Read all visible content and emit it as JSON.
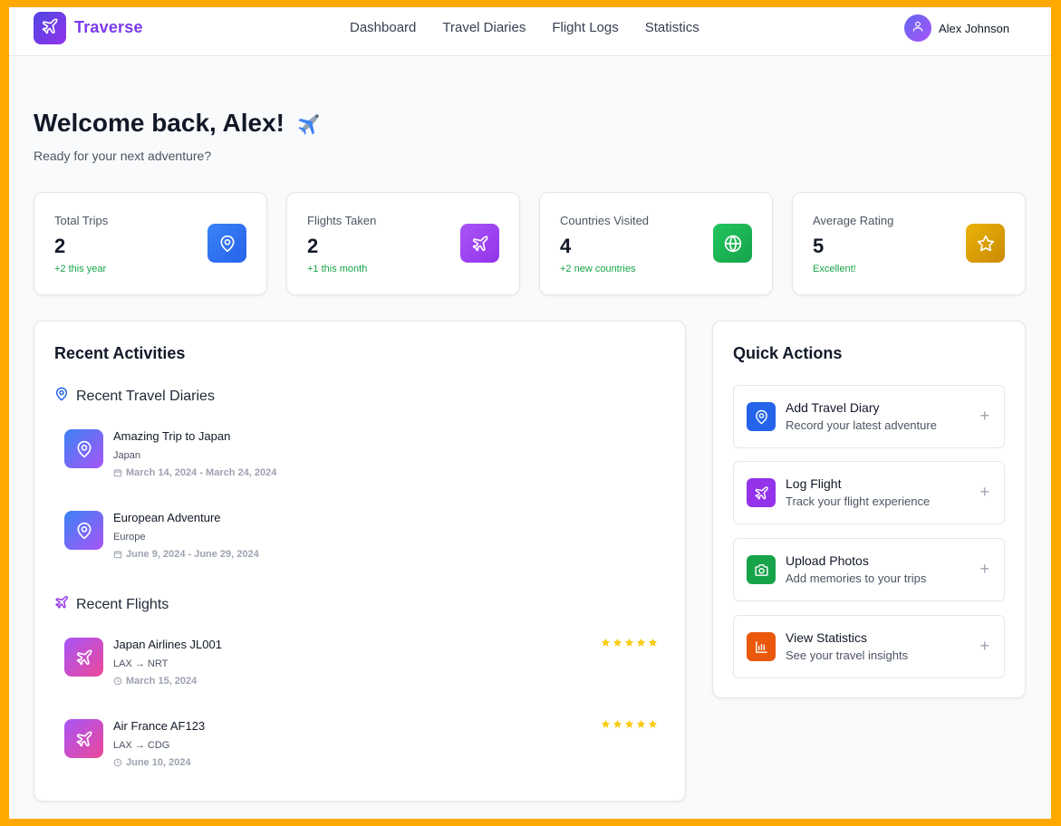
{
  "brand": {
    "name": "Traverse",
    "logo_icon": "airplane-icon"
  },
  "nav": {
    "items": [
      "Dashboard",
      "Travel Diaries",
      "Flight Logs",
      "Statistics"
    ]
  },
  "user": {
    "name": "Alex Johnson",
    "avatar_icon": "user-icon"
  },
  "welcome": {
    "title": "Welcome back, Alex!",
    "subtitle": "Ready for your next adventure?"
  },
  "stats": [
    {
      "label": "Total Trips",
      "value": "2",
      "note": "+2 this year",
      "icon": "map-pin-icon",
      "color": "#2563eb"
    },
    {
      "label": "Flights Taken",
      "value": "2",
      "note": "+1 this month",
      "icon": "airplane-icon",
      "color": "#9333ea"
    },
    {
      "label": "Countries Visited",
      "value": "4",
      "note": "+2 new countries",
      "icon": "globe-icon",
      "color": "#16a34a"
    },
    {
      "label": "Average Rating",
      "value": "5",
      "note": "Excellent!",
      "icon": "star-icon",
      "color": "#ca8a04"
    }
  ],
  "recent": {
    "title": "Recent Activities",
    "diaries_heading": "Recent Travel Diaries",
    "diaries": [
      {
        "title": "Amazing Trip to Japan",
        "location": "Japan",
        "dates": "March 14, 2024 - March 24, 2024"
      },
      {
        "title": "European Adventure",
        "location": "Europe",
        "dates": "June 9, 2024 - June 29, 2024"
      }
    ],
    "flights_heading": "Recent Flights",
    "flights": [
      {
        "title": "Japan Airlines JL001",
        "route": "LAX → NRT",
        "date": "March 15, 2024",
        "rating": 5
      },
      {
        "title": "Air France AF123",
        "route": "LAX → CDG",
        "date": "June 10, 2024",
        "rating": 5
      }
    ]
  },
  "quick_actions": {
    "title": "Quick Actions",
    "items": [
      {
        "title": "Add Travel Diary",
        "subtitle": "Record your latest adventure",
        "icon": "map-pin-icon",
        "color": "#2563eb"
      },
      {
        "title": "Log Flight",
        "subtitle": "Track your flight experience",
        "icon": "airplane-icon",
        "color": "#9333ea"
      },
      {
        "title": "Upload Photos",
        "subtitle": "Add memories to your trips",
        "icon": "camera-icon",
        "color": "#16a34a"
      },
      {
        "title": "View Statistics",
        "subtitle": "See your travel insights",
        "icon": "bar-chart-icon",
        "color": "#ea580c"
      }
    ]
  }
}
